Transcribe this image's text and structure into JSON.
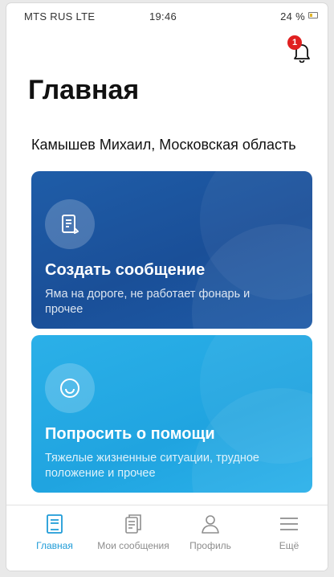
{
  "status_bar": {
    "carrier": "MTS RUS LTE",
    "time": "19:46",
    "battery": "24 %"
  },
  "notifications": {
    "count": "1"
  },
  "page": {
    "title": "Главная",
    "user_line": "Камышев Михаил, Московская область"
  },
  "cards": {
    "create": {
      "title": "Создать сообщение",
      "subtitle": "Яма на дороге, не работает фонарь и прочее",
      "icon": "document-icon"
    },
    "help": {
      "title": "Попросить о помощи",
      "subtitle": "Тяжелые жизненные ситуации, трудное положение и прочее",
      "icon": "smile-icon"
    }
  },
  "tabs": [
    {
      "label": "Главная",
      "icon": "home-document-icon",
      "active": true
    },
    {
      "label": "Мои сообщения",
      "icon": "messages-icon",
      "active": false
    },
    {
      "label": "Профиль",
      "icon": "profile-icon",
      "active": false
    },
    {
      "label": "Ещё",
      "icon": "menu-icon",
      "active": false
    }
  ],
  "colors": {
    "card_create": "#1a4f98",
    "card_help": "#20a4e0",
    "tab_active": "#1e9bd7",
    "tab_inactive": "#8d8d8d",
    "badge": "#e02020"
  }
}
